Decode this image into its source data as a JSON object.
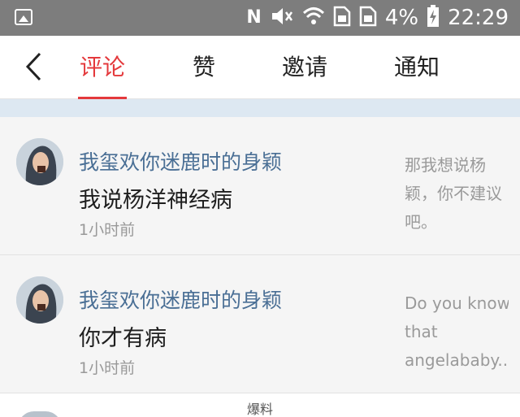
{
  "status_bar": {
    "icons": [
      "image-icon",
      "nfc-icon",
      "mute-icon",
      "wifi-icon",
      "sim1-icon",
      "sim2-icon",
      "battery-charging-icon"
    ],
    "nfc_glyph": "N",
    "battery_percent": "4%",
    "time": "22:29"
  },
  "nav": {
    "back_icon": "back-chevron-icon",
    "tabs": [
      {
        "label": "评论",
        "active": true
      },
      {
        "label": "赞",
        "active": false
      },
      {
        "label": "邀请",
        "active": false
      },
      {
        "label": "通知",
        "active": false
      }
    ],
    "accent_color": "#e4393c"
  },
  "comments": [
    {
      "user": "我玺欢你迷鹿时的身颖",
      "text": "我说杨洋神经病",
      "time": "1小时前",
      "quote_lines": [
        "那我想说杨",
        "颖，你不建议",
        "吧。"
      ]
    },
    {
      "user": "我玺欢你迷鹿时的身颖",
      "text": "你才有病",
      "time": "1小时前",
      "quote_lines": [
        "Do you know",
        "that",
        "angelababy..."
      ]
    }
  ],
  "watermark": "爆料",
  "colors": {
    "status_bar_bg": "#7d7d7d",
    "username": "#4a6f95",
    "quote_text": "#9a9a9a"
  }
}
